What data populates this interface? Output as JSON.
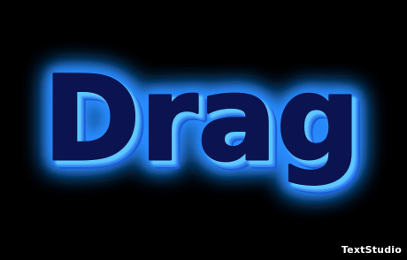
{
  "word": "Drag",
  "watermark": "TextStudio",
  "colors": {
    "background": "#000000",
    "glow": "#2a8cff",
    "extrude": "#1d5fd6",
    "fill": "#0b1450",
    "rim": "#5ec8ff",
    "watermark": "#ffffff"
  }
}
